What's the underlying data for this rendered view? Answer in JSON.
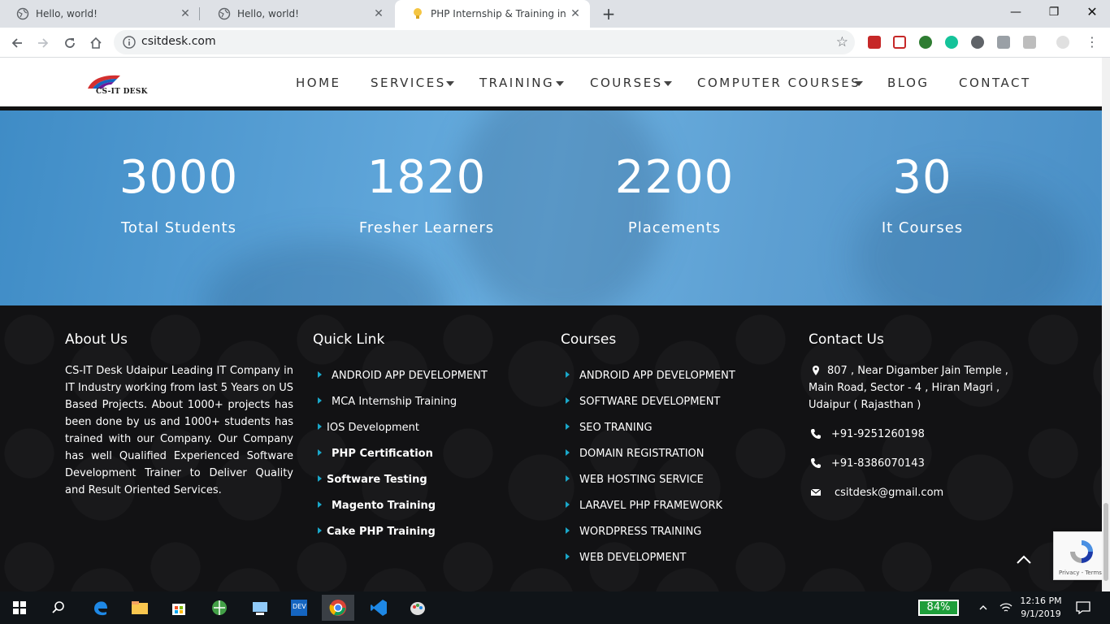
{
  "browser": {
    "tabs": [
      {
        "title": "Hello, world!"
      },
      {
        "title": "Hello, world!"
      },
      {
        "title": "PHP Internship & Training in Uda"
      }
    ],
    "url": "csitdesk.com"
  },
  "site": {
    "logo_text": "CS-IT DESK",
    "nav": [
      "HOME",
      "SERVICES",
      "TRAINING",
      "COURSES",
      "COMPUTER COURSES",
      "BLOG",
      "CONTACT"
    ]
  },
  "stats": [
    {
      "value": "3000",
      "label": "Total Students"
    },
    {
      "value": "1820",
      "label": "Fresher Learners"
    },
    {
      "value": "2200",
      "label": "Placements"
    },
    {
      "value": "30",
      "label": "It Courses"
    }
  ],
  "footer": {
    "about": {
      "heading": "About Us",
      "text": "CS-IT Desk Udaipur Leading IT Company in IT Industry working from last 5 Years on US Based Projects. About 1000+ projects has been done by us and 1000+ students has trained with our Company. Our Company has well Qualified Experienced Software Development Trainer to Deliver Quality and Result Oriented Services."
    },
    "quick": {
      "heading": "Quick Link",
      "links": [
        "ANDROID APP DEVELOPMENT",
        "MCA Internship Training",
        "IOS Development",
        "PHP Certification",
        "Software Testing",
        "Magento Training",
        "Cake PHP Training"
      ]
    },
    "courses": {
      "heading": "Courses",
      "links": [
        "ANDROID APP DEVELOPMENT",
        "SOFTWARE DEVELOPMENT",
        "SEO TRANING",
        "DOMAIN REGISTRATION",
        "WEB HOSTING SERVICE",
        "LARAVEL PHP FRAMEWORK",
        "WORDPRESS TRAINING",
        "WEB DEVELOPMENT"
      ]
    },
    "contact": {
      "heading": "Contact Us",
      "address_1": "807 , Near Digamber Jain Temple ,",
      "address_2": "Main Road, Sector - 4 , Hiran Magri ,",
      "address_3": "Udaipur ( Rajasthan )",
      "phone_1": "+91-9251260198",
      "phone_2": "+91-8386070143",
      "email": "csitdesk@gmail.com"
    }
  },
  "recaptcha": {
    "text": "Privacy - Terms"
  },
  "taskbar": {
    "battery": "84%",
    "time": "12:16 PM",
    "date": "9/1/2019"
  },
  "colors": {
    "accent": "#1aa7c9",
    "stats_bg": "#5aa1d6",
    "footer_bg": "#121214"
  }
}
